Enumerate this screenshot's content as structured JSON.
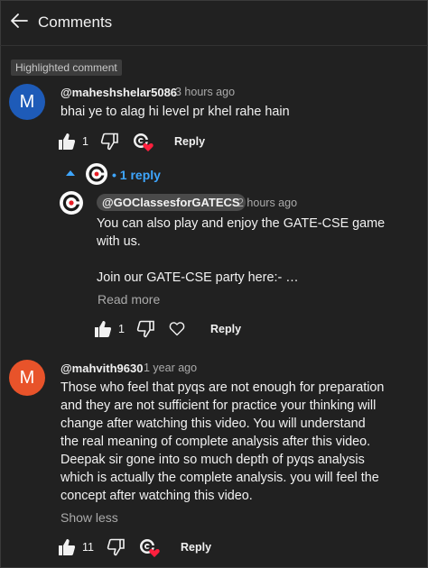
{
  "header": {
    "title": "Comments"
  },
  "highlighted_label": "Highlighted comment",
  "comments": [
    {
      "avatar_letter": "M",
      "avatar_color": "#1e5bb8",
      "author": "@maheshshelar5086",
      "time": "3 hours ago",
      "text": "bhai ye to alag hi level pr khel rahe hain",
      "likes": "1",
      "reply_label": "Reply",
      "replies_toggle": "1 reply",
      "reply": {
        "author": "@GOClassesforGATECS",
        "time": "2 hours ago",
        "text": "You can also play and enjoy the GATE-CSE game\nwith us.\n\nJoin our GATE-CSE party here:- …",
        "read_more": "Read more",
        "likes": "1",
        "reply_label": "Reply"
      }
    },
    {
      "avatar_letter": "M",
      "avatar_color": "#e8532a",
      "author": "@mahvith9630",
      "time": "1 year ago",
      "text": "Those who feel that pyqs are not enough for preparation\nand they are not sufficient for practice your thinking will\nchange after watching this video. You will understand\nthe real meaning of complete analysis after this video.\nDeepak sir gone into so much depth of pyqs analysis\nwhich is actually the complete analysis. you will feel the\nconcept after watching this video.",
      "show_less": "Show less",
      "likes": "11",
      "reply_label": "Reply"
    }
  ]
}
